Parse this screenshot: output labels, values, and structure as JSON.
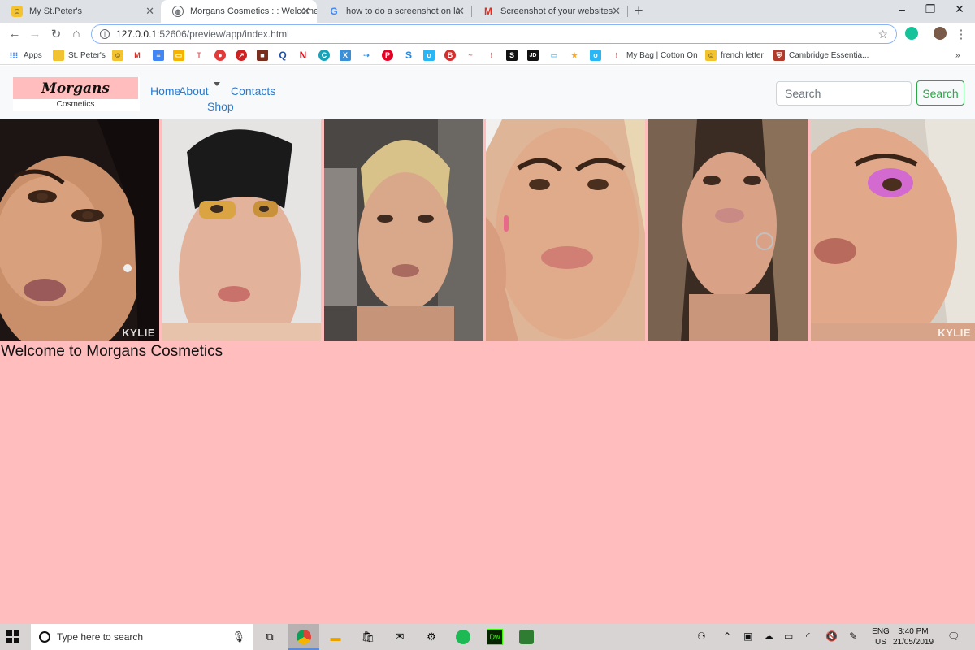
{
  "browser": {
    "tabs": [
      {
        "title": "My St.Peter's",
        "icon": "smiley-favicon",
        "active": false
      },
      {
        "title": "Morgans Cosmetics : : Welcome",
        "icon": "globe-favicon",
        "active": true
      },
      {
        "title": "how to do a screenshot on lapot",
        "icon": "google-favicon",
        "active": false
      },
      {
        "title": "Screenshot of your websites - pa",
        "icon": "gmail-favicon",
        "active": false
      }
    ],
    "url_host": "127.0.0.1",
    "url_rest": ":52606/preview/app/index.html",
    "bookmarks": {
      "apps": "Apps",
      "st_peters": "St. Peter's",
      "cotton_on": "My Bag | Cotton On",
      "french_letter": "french letter",
      "cambridge": "Cambridge Essentia...",
      "more": "»"
    }
  },
  "site": {
    "logo_main": "Morgans",
    "logo_sub": "Cosmetics",
    "nav": {
      "home": "Home",
      "about": "About",
      "shop": "Shop",
      "contacts": "Contacts"
    },
    "search_placeholder": "Search",
    "search_button": "Search",
    "gallery_watermark_1": "KYLIE",
    "gallery_watermark_6": "KYLIE",
    "welcome_heading": "Welcome to Morgans Cosmetics"
  },
  "taskbar": {
    "search_placeholder": "Type here to search",
    "lang_top": "ENG",
    "lang_bottom": "US",
    "time": "3:40 PM",
    "date": "21/05/2019"
  },
  "colors": {
    "page_background": "#ffbdbd",
    "nav_link": "#2b7bcd",
    "search_button": "#28a745"
  }
}
